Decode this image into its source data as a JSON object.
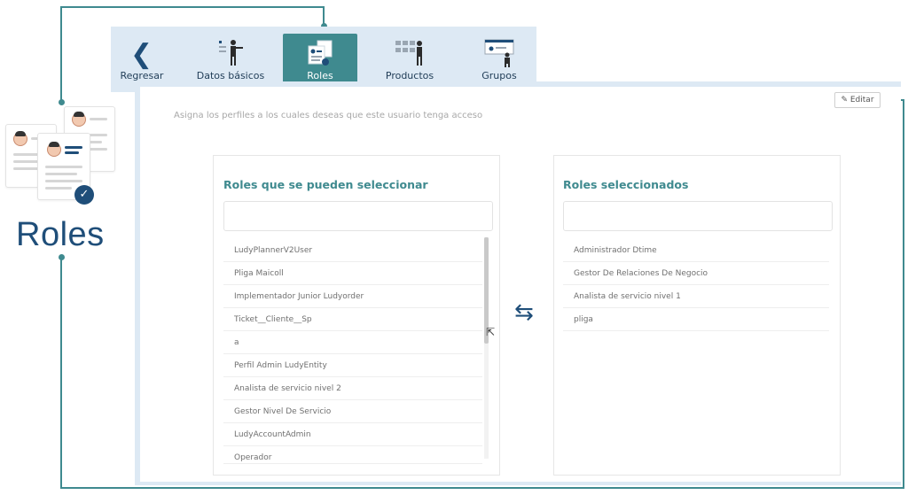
{
  "illustration": {
    "title": "Roles"
  },
  "tabs": [
    {
      "id": "regresar",
      "label": "Regresar",
      "icon": "back-chevron-icon"
    },
    {
      "id": "datos",
      "label": "Datos básicos",
      "icon": "person-presenting-icon"
    },
    {
      "id": "roles",
      "label": "Roles",
      "icon": "role-cards-icon",
      "active": true
    },
    {
      "id": "productos",
      "label": "Productos",
      "icon": "person-products-icon"
    },
    {
      "id": "grupos",
      "label": "Grupos",
      "icon": "person-board-icon"
    }
  ],
  "main": {
    "hint": "Asigna los perfiles a los cuales deseas que este usuario tenga acceso",
    "edit_label": "Editar"
  },
  "available": {
    "title": "Roles que se pueden seleccionar",
    "search_placeholder": "",
    "items": [
      "LudyPlannerV2User",
      "Pliga Maicoll",
      "Implementador Junior Ludyorder",
      "Ticket__Cliente__Sp",
      "a",
      "Perfil Admin LudyEntity",
      "Analista de servicio nivel 2",
      "Gestor Nivel De Servicio",
      "LudyAccountAdmin",
      "Operador"
    ]
  },
  "selected": {
    "title": "Roles seleccionados",
    "search_placeholder": "",
    "items": [
      "Administrador Dtime",
      "Gestor De Relaciones De Negocio",
      "Analista de servicio nivel 1",
      "pliga"
    ]
  },
  "colors": {
    "accent": "#3f8a8f",
    "brand": "#1f4e79",
    "tabbar": "#dde9f4"
  }
}
